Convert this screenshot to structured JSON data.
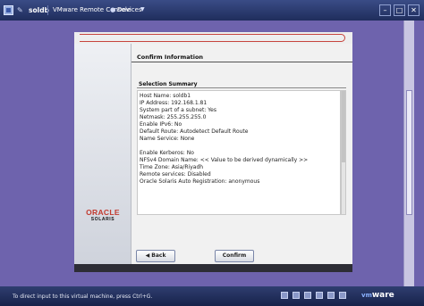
{
  "titlebar": {
    "host": "soldb",
    "console": "VMware Remote Console",
    "devices": "Devices",
    "separator_dot": "●",
    "arrow": "▼",
    "minimize": "–",
    "maximize": "□",
    "close": "✕"
  },
  "logo": {
    "oracle": "ORACLE",
    "solaris": "SOLARIS"
  },
  "installer": {
    "heading": "Confirm Information",
    "summary_title": "Selection Summary",
    "summary_lines": [
      "Host Name: soldb1",
      "IP Address: 192.168.1.81",
      "System part of a subnet: Yes",
      "Netmask: 255.255.255.0",
      "Enable IPv6: No",
      "Default Route: Autodetect Default Route",
      "Name Service: None",
      "",
      "Enable Kerberos: No",
      "NFSv4 Domain Name: << Value to be derived dynamically >>",
      "Time Zone: Asia/Riyadh",
      "Remote services: Disabled",
      "Oracle Solaris Auto Registration: anonymous"
    ],
    "back_label": "◀ Back",
    "confirm_label": "Confirm"
  },
  "statusbar": {
    "text": "To direct input to this virtual machine, press Ctrl+G.",
    "brand": "vm",
    "brand_suffix": "ware"
  }
}
